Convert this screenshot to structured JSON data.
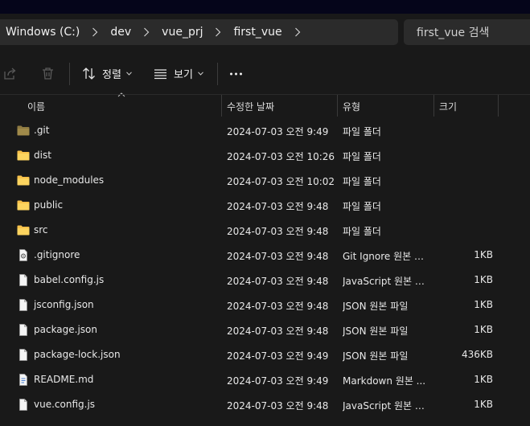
{
  "breadcrumb": [
    "Windows (C:)",
    "dev",
    "vue_prj",
    "first_vue"
  ],
  "search": {
    "placeholder": "first_vue 검색"
  },
  "toolbar": {
    "sort_label": "정렬",
    "view_label": "보기",
    "more_label": "···"
  },
  "columns": {
    "name": "이름",
    "date": "수정한 날짜",
    "type": "유형",
    "size": "크기"
  },
  "files": [
    {
      "name": ".git",
      "date": "2024-07-03 오전 9:49",
      "type": "파일 폴더",
      "size": "",
      "icon": "folder-dim-icon"
    },
    {
      "name": "dist",
      "date": "2024-07-03 오전 10:26",
      "type": "파일 폴더",
      "size": "",
      "icon": "folder-icon"
    },
    {
      "name": "node_modules",
      "date": "2024-07-03 오전 10:02",
      "type": "파일 폴더",
      "size": "",
      "icon": "folder-icon"
    },
    {
      "name": "public",
      "date": "2024-07-03 오전 9:48",
      "type": "파일 폴더",
      "size": "",
      "icon": "folder-icon"
    },
    {
      "name": "src",
      "date": "2024-07-03 오전 9:48",
      "type": "파일 폴더",
      "size": "",
      "icon": "folder-icon"
    },
    {
      "name": ".gitignore",
      "date": "2024-07-03 오전 9:48",
      "type": "Git Ignore 원본 파...",
      "size": "1KB",
      "icon": "settings-file-icon"
    },
    {
      "name": "babel.config.js",
      "date": "2024-07-03 오전 9:48",
      "type": "JavaScript 원본 파...",
      "size": "1KB",
      "icon": "file-icon"
    },
    {
      "name": "jsconfig.json",
      "date": "2024-07-03 오전 9:48",
      "type": "JSON 원본 파일",
      "size": "1KB",
      "icon": "file-icon"
    },
    {
      "name": "package.json",
      "date": "2024-07-03 오전 9:48",
      "type": "JSON 원본 파일",
      "size": "1KB",
      "icon": "file-icon"
    },
    {
      "name": "package-lock.json",
      "date": "2024-07-03 오전 9:49",
      "type": "JSON 원본 파일",
      "size": "436KB",
      "icon": "file-icon"
    },
    {
      "name": "README.md",
      "date": "2024-07-03 오전 9:49",
      "type": "Markdown 원본 ...",
      "size": "1KB",
      "icon": "text-file-icon"
    },
    {
      "name": "vue.config.js",
      "date": "2024-07-03 오전 9:48",
      "type": "JavaScript 원본 파...",
      "size": "1KB",
      "icon": "file-icon"
    }
  ],
  "colors": {
    "background": "#191919",
    "panel": "#2b2b2b",
    "folder": "#f7c14a",
    "folder_dim": "#a08a4a"
  }
}
